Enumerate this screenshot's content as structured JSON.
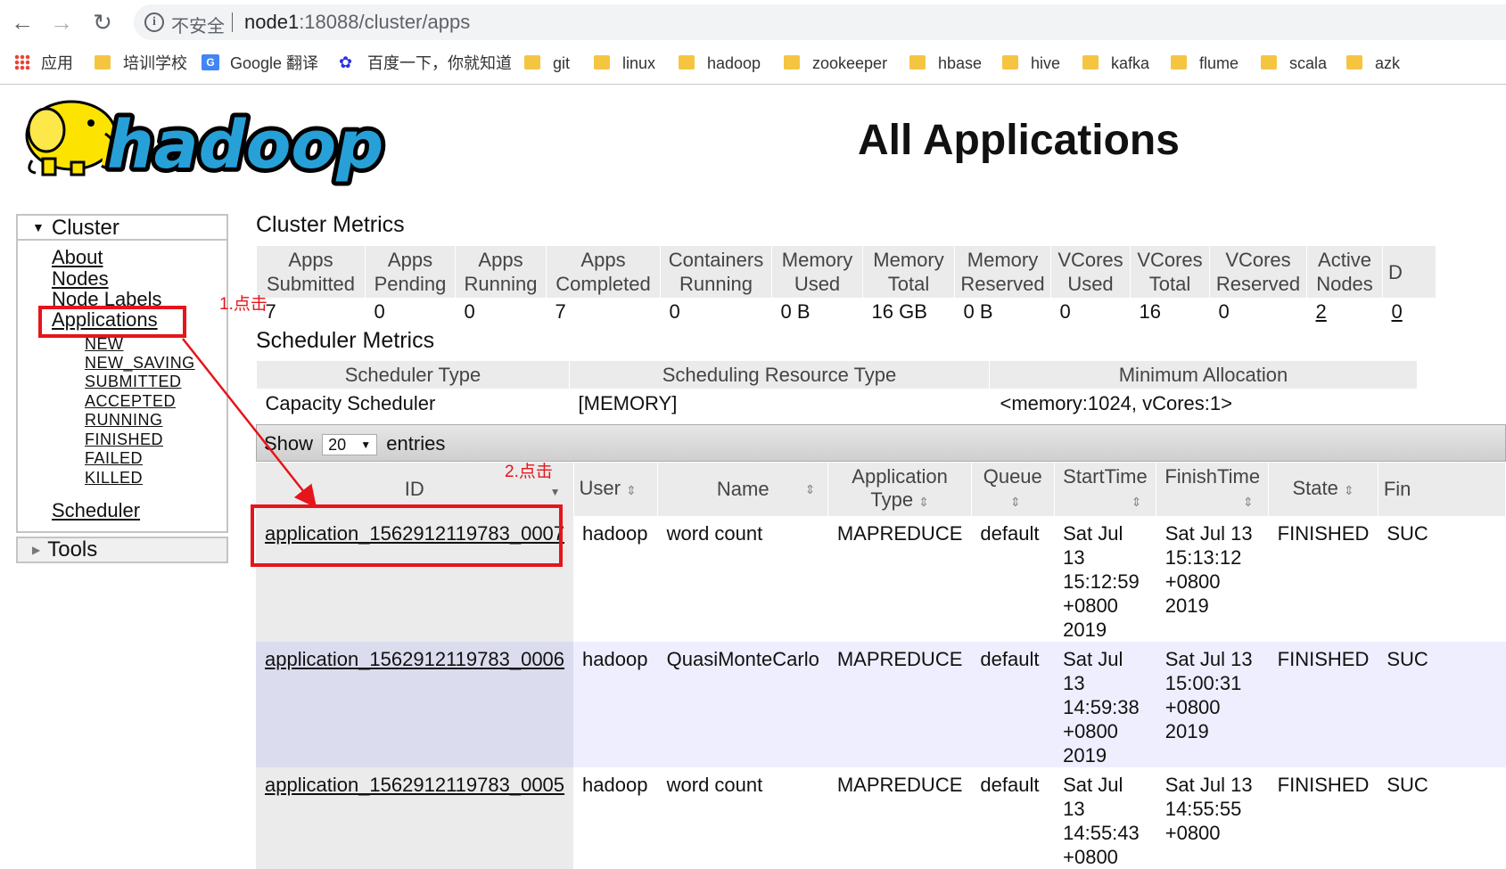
{
  "browser": {
    "insecure_label": "不安全",
    "url_host": "node1",
    "url_rest": ":18088/cluster/apps",
    "back_glyph": "←",
    "forward_glyph": "→",
    "reload_glyph": "↻",
    "info_glyph": "i",
    "bookmarks": [
      {
        "label": "应用",
        "icon": "apps-grid-icon"
      },
      {
        "label": "培训学校",
        "icon": "folder-icon"
      },
      {
        "label": "Google 翻译",
        "icon": "google-translate-icon"
      },
      {
        "label": "百度一下，你就知道",
        "icon": "baidu-paw-icon"
      },
      {
        "label": "git",
        "icon": "folder-icon"
      },
      {
        "label": "linux",
        "icon": "folder-icon"
      },
      {
        "label": "hadoop",
        "icon": "folder-icon"
      },
      {
        "label": "zookeeper",
        "icon": "folder-icon"
      },
      {
        "label": "hbase",
        "icon": "folder-icon"
      },
      {
        "label": "hive",
        "icon": "folder-icon"
      },
      {
        "label": "kafka",
        "icon": "folder-icon"
      },
      {
        "label": "flume",
        "icon": "folder-icon"
      },
      {
        "label": "scala",
        "icon": "folder-icon"
      },
      {
        "label": "azk",
        "icon": "folder-icon"
      }
    ]
  },
  "header": {
    "logo_text": "hadoop",
    "title": "All Applications"
  },
  "sidebar": {
    "cluster_label": "Cluster",
    "links": [
      "About",
      "Nodes",
      "Node Labels",
      "Applications"
    ],
    "app_states": [
      "NEW",
      "NEW_SAVING",
      "SUBMITTED",
      "ACCEPTED",
      "RUNNING",
      "FINISHED",
      "FAILED",
      "KILLED"
    ],
    "scheduler_label": "Scheduler",
    "tools_label": "Tools"
  },
  "cluster_metrics": {
    "heading": "Cluster Metrics",
    "headers": [
      [
        "Apps",
        "Submitted"
      ],
      [
        "Apps",
        "Pending"
      ],
      [
        "Apps",
        "Running"
      ],
      [
        "Apps",
        "Completed"
      ],
      [
        "Containers",
        "Running"
      ],
      [
        "Memory",
        "Used"
      ],
      [
        "Memory",
        "Total"
      ],
      [
        "Memory",
        "Reserved"
      ],
      [
        "VCores",
        "Used"
      ],
      [
        "VCores",
        "Total"
      ],
      [
        "VCores",
        "Reserved"
      ],
      [
        "Active",
        "Nodes"
      ],
      [
        "D",
        ""
      ]
    ],
    "values": [
      "7",
      "0",
      "0",
      "7",
      "0",
      "0 B",
      "16 GB",
      "0 B",
      "0",
      "16",
      "0",
      "2",
      "0"
    ]
  },
  "scheduler_metrics": {
    "heading": "Scheduler Metrics",
    "headers": [
      "Scheduler Type",
      "Scheduling Resource Type",
      "Minimum Allocation"
    ],
    "values": [
      "Capacity Scheduler",
      "[MEMORY]",
      "<memory:1024, vCores:1>"
    ]
  },
  "entries": {
    "show_label": "Show",
    "page_size": "20",
    "entries_label": "entries"
  },
  "apps_table": {
    "headers": {
      "id": "ID",
      "user": "User",
      "name": "Name",
      "type_line1": "Application",
      "type_line2": "Type",
      "queue": "Queue",
      "start": "StartTime",
      "finish": "FinishTime",
      "state": "State",
      "final": "Fin"
    },
    "rows": [
      {
        "id": "application_1562912119783_0007",
        "user": "hadoop",
        "name": "word count",
        "type": "MAPREDUCE",
        "queue": "default",
        "start": [
          "Sat Jul 13",
          "15:12:59",
          "+0800",
          "2019"
        ],
        "finish": [
          "Sat Jul 13",
          "15:13:12",
          "+0800",
          "2019"
        ],
        "state": "FINISHED",
        "final": "SUC"
      },
      {
        "id": "application_1562912119783_0006",
        "user": "hadoop",
        "name": "QuasiMonteCarlo",
        "type": "MAPREDUCE",
        "queue": "default",
        "start": [
          "Sat Jul 13",
          "14:59:38",
          "+0800",
          "2019"
        ],
        "finish": [
          "Sat Jul 13",
          "15:00:31",
          "+0800",
          "2019"
        ],
        "state": "FINISHED",
        "final": "SUC"
      },
      {
        "id": "application_1562912119783_0005",
        "user": "hadoop",
        "name": "word count",
        "type": "MAPREDUCE",
        "queue": "default",
        "start": [
          "Sat Jul 13",
          "14:55:43",
          "+0800",
          ""
        ],
        "finish": [
          "Sat Jul 13",
          "14:55:55",
          "+0800",
          ""
        ],
        "state": "FINISHED",
        "final": "SUC"
      }
    ]
  },
  "annotations": {
    "step1": "1.点击",
    "step2": "2.点击",
    "color": "#e5151b"
  }
}
